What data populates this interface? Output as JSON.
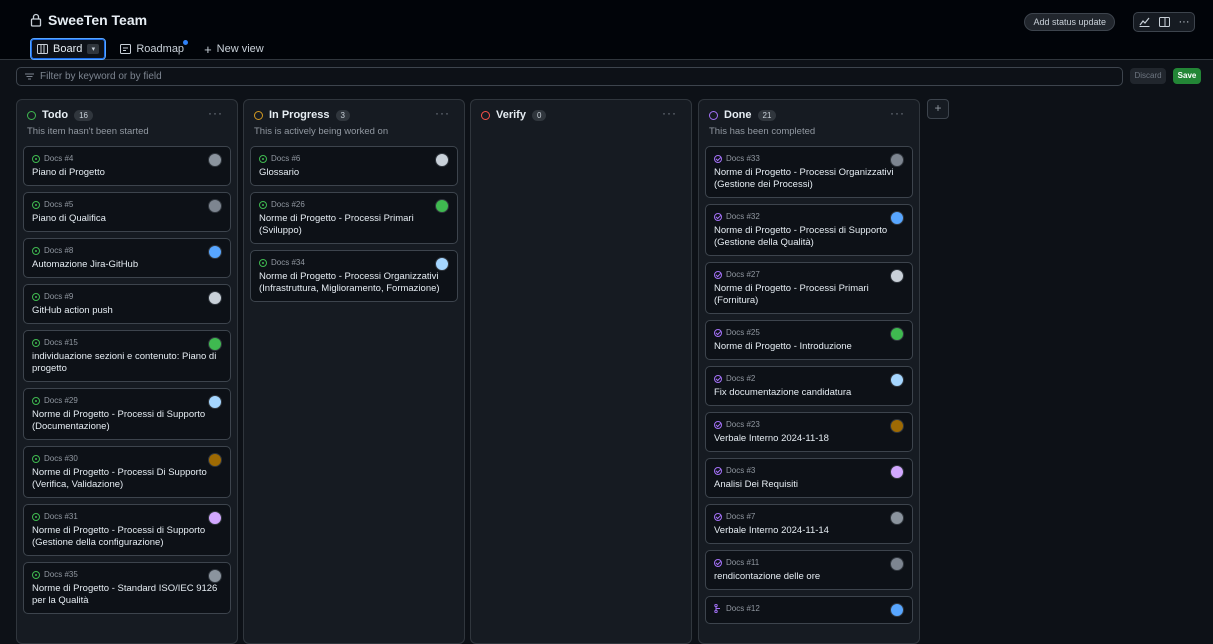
{
  "project": {
    "title": "SweeTen Team"
  },
  "views": {
    "board_label": "Board",
    "roadmap_label": "Roadmap",
    "new_view_label": "New view"
  },
  "header_actions": {
    "status_update_label": "Add status update"
  },
  "filter": {
    "placeholder": "Filter by keyword or by field",
    "discard_label": "Discard",
    "save_label": "Save"
  },
  "colors": {
    "todo": "#3fb950",
    "in_progress": "#d29922",
    "verify": "#f85149",
    "done": "#a371f7",
    "accent": "#2f81f7"
  },
  "columns": [
    {
      "name": "Todo",
      "count": "16",
      "description": "This item hasn't been started",
      "cards": [
        {
          "ref": "Docs #4",
          "title": "Piano di Progetto"
        },
        {
          "ref": "Docs #5",
          "title": "Piano di Qualifica"
        },
        {
          "ref": "Docs #8",
          "title": "Automazione Jira-GitHub"
        },
        {
          "ref": "Docs #9",
          "title": "GitHub action push"
        },
        {
          "ref": "Docs #15",
          "title": "individuazione sezioni e contenuto: Piano di progetto"
        },
        {
          "ref": "Docs #29",
          "title": "Norme di Progetto - Processi di Supporto (Documentazione)"
        },
        {
          "ref": "Docs #30",
          "title": "Norme di Progetto - Processi Di Supporto (Verifica, Validazione)"
        },
        {
          "ref": "Docs #31",
          "title": "Norme di Progetto - Processi di Supporto (Gestione della configurazione)"
        },
        {
          "ref": "Docs #35",
          "title": "Norme di Progetto - Standard ISO/IEC 9126 per la Qualità"
        }
      ]
    },
    {
      "name": "In Progress",
      "count": "3",
      "description": "This is actively being worked on",
      "cards": [
        {
          "ref": "Docs #6",
          "title": "Glossario"
        },
        {
          "ref": "Docs #26",
          "title": "Norme di Progetto - Processi Primari (Sviluppo)"
        },
        {
          "ref": "Docs #34",
          "title": "Norme di Progetto - Processi Organizzativi (Infrastruttura, Miglioramento, Formazione)"
        }
      ]
    },
    {
      "name": "Verify",
      "count": "0",
      "description": "",
      "cards": []
    },
    {
      "name": "Done",
      "count": "21",
      "description": "This has been completed",
      "cards": [
        {
          "ref": "Docs #33",
          "title": "Norme di Progetto - Processi Organizzativi (Gestione dei Processi)"
        },
        {
          "ref": "Docs #32",
          "title": "Norme di Progetto - Processi di Supporto (Gestione della Qualità)"
        },
        {
          "ref": "Docs #27",
          "title": "Norme di Progetto - Processi Primari (Fornitura)"
        },
        {
          "ref": "Docs #25",
          "title": "Norme di Progetto - Introduzione"
        },
        {
          "ref": "Docs #2",
          "title": "Fix documentazione candidatura"
        },
        {
          "ref": "Docs #23",
          "title": "Verbale Interno 2024-11-18"
        },
        {
          "ref": "Docs #3",
          "title": "Analisi Dei Requisiti"
        },
        {
          "ref": "Docs #7",
          "title": "Verbale Interno 2024-11-14"
        },
        {
          "ref": "Docs #11",
          "title": "rendicontazione delle ore"
        },
        {
          "ref": "Docs #12",
          "title": ""
        }
      ]
    }
  ]
}
